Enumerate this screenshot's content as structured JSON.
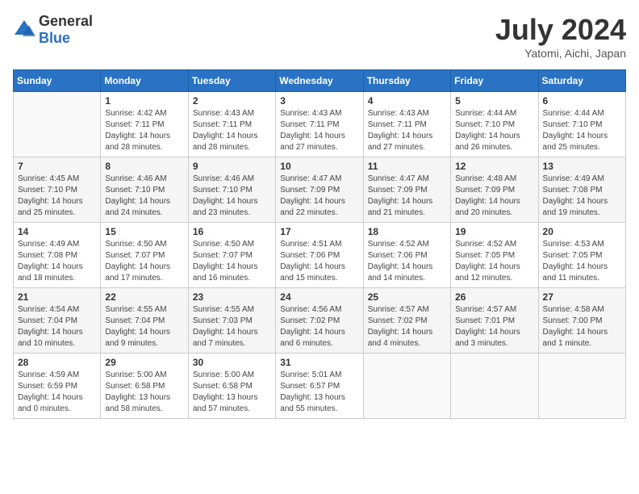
{
  "header": {
    "logo_general": "General",
    "logo_blue": "Blue",
    "month_title": "July 2024",
    "location": "Yatomi, Aichi, Japan"
  },
  "weekdays": [
    "Sunday",
    "Monday",
    "Tuesday",
    "Wednesday",
    "Thursday",
    "Friday",
    "Saturday"
  ],
  "weeks": [
    [
      {
        "day": "",
        "info": ""
      },
      {
        "day": "1",
        "info": "Sunrise: 4:42 AM\nSunset: 7:11 PM\nDaylight: 14 hours\nand 28 minutes."
      },
      {
        "day": "2",
        "info": "Sunrise: 4:43 AM\nSunset: 7:11 PM\nDaylight: 14 hours\nand 28 minutes."
      },
      {
        "day": "3",
        "info": "Sunrise: 4:43 AM\nSunset: 7:11 PM\nDaylight: 14 hours\nand 27 minutes."
      },
      {
        "day": "4",
        "info": "Sunrise: 4:43 AM\nSunset: 7:11 PM\nDaylight: 14 hours\nand 27 minutes."
      },
      {
        "day": "5",
        "info": "Sunrise: 4:44 AM\nSunset: 7:10 PM\nDaylight: 14 hours\nand 26 minutes."
      },
      {
        "day": "6",
        "info": "Sunrise: 4:44 AM\nSunset: 7:10 PM\nDaylight: 14 hours\nand 25 minutes."
      }
    ],
    [
      {
        "day": "7",
        "info": "Sunrise: 4:45 AM\nSunset: 7:10 PM\nDaylight: 14 hours\nand 25 minutes."
      },
      {
        "day": "8",
        "info": "Sunrise: 4:46 AM\nSunset: 7:10 PM\nDaylight: 14 hours\nand 24 minutes."
      },
      {
        "day": "9",
        "info": "Sunrise: 4:46 AM\nSunset: 7:10 PM\nDaylight: 14 hours\nand 23 minutes."
      },
      {
        "day": "10",
        "info": "Sunrise: 4:47 AM\nSunset: 7:09 PM\nDaylight: 14 hours\nand 22 minutes."
      },
      {
        "day": "11",
        "info": "Sunrise: 4:47 AM\nSunset: 7:09 PM\nDaylight: 14 hours\nand 21 minutes."
      },
      {
        "day": "12",
        "info": "Sunrise: 4:48 AM\nSunset: 7:09 PM\nDaylight: 14 hours\nand 20 minutes."
      },
      {
        "day": "13",
        "info": "Sunrise: 4:49 AM\nSunset: 7:08 PM\nDaylight: 14 hours\nand 19 minutes."
      }
    ],
    [
      {
        "day": "14",
        "info": "Sunrise: 4:49 AM\nSunset: 7:08 PM\nDaylight: 14 hours\nand 18 minutes."
      },
      {
        "day": "15",
        "info": "Sunrise: 4:50 AM\nSunset: 7:07 PM\nDaylight: 14 hours\nand 17 minutes."
      },
      {
        "day": "16",
        "info": "Sunrise: 4:50 AM\nSunset: 7:07 PM\nDaylight: 14 hours\nand 16 minutes."
      },
      {
        "day": "17",
        "info": "Sunrise: 4:51 AM\nSunset: 7:06 PM\nDaylight: 14 hours\nand 15 minutes."
      },
      {
        "day": "18",
        "info": "Sunrise: 4:52 AM\nSunset: 7:06 PM\nDaylight: 14 hours\nand 14 minutes."
      },
      {
        "day": "19",
        "info": "Sunrise: 4:52 AM\nSunset: 7:05 PM\nDaylight: 14 hours\nand 12 minutes."
      },
      {
        "day": "20",
        "info": "Sunrise: 4:53 AM\nSunset: 7:05 PM\nDaylight: 14 hours\nand 11 minutes."
      }
    ],
    [
      {
        "day": "21",
        "info": "Sunrise: 4:54 AM\nSunset: 7:04 PM\nDaylight: 14 hours\nand 10 minutes."
      },
      {
        "day": "22",
        "info": "Sunrise: 4:55 AM\nSunset: 7:04 PM\nDaylight: 14 hours\nand 9 minutes."
      },
      {
        "day": "23",
        "info": "Sunrise: 4:55 AM\nSunset: 7:03 PM\nDaylight: 14 hours\nand 7 minutes."
      },
      {
        "day": "24",
        "info": "Sunrise: 4:56 AM\nSunset: 7:02 PM\nDaylight: 14 hours\nand 6 minutes."
      },
      {
        "day": "25",
        "info": "Sunrise: 4:57 AM\nSunset: 7:02 PM\nDaylight: 14 hours\nand 4 minutes."
      },
      {
        "day": "26",
        "info": "Sunrise: 4:57 AM\nSunset: 7:01 PM\nDaylight: 14 hours\nand 3 minutes."
      },
      {
        "day": "27",
        "info": "Sunrise: 4:58 AM\nSunset: 7:00 PM\nDaylight: 14 hours\nand 1 minute."
      }
    ],
    [
      {
        "day": "28",
        "info": "Sunrise: 4:59 AM\nSunset: 6:59 PM\nDaylight: 14 hours\nand 0 minutes."
      },
      {
        "day": "29",
        "info": "Sunrise: 5:00 AM\nSunset: 6:58 PM\nDaylight: 13 hours\nand 58 minutes."
      },
      {
        "day": "30",
        "info": "Sunrise: 5:00 AM\nSunset: 6:58 PM\nDaylight: 13 hours\nand 57 minutes."
      },
      {
        "day": "31",
        "info": "Sunrise: 5:01 AM\nSunset: 6:57 PM\nDaylight: 13 hours\nand 55 minutes."
      },
      {
        "day": "",
        "info": ""
      },
      {
        "day": "",
        "info": ""
      },
      {
        "day": "",
        "info": ""
      }
    ]
  ]
}
